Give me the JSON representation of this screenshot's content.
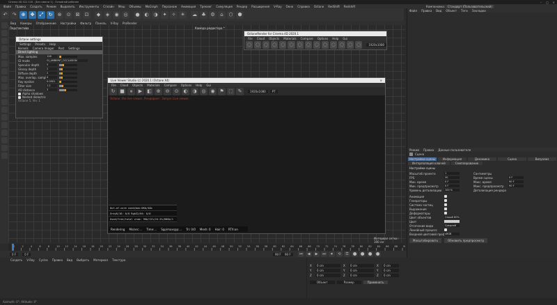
{
  "window": {
    "title": "Cinema 4D S22.118 - [Без имени 1] - Основной рабочее"
  },
  "main_menu": [
    "Файл",
    "Правка",
    "Создать",
    "Режим",
    "Выделить",
    "Инструменты",
    "Сплайн",
    "Меш",
    "Объемы",
    "MoGraph",
    "Персонаж",
    "Анимация",
    "Трекинг",
    "Симуляция",
    "Рендер",
    "Расширения",
    "V-Ray",
    "Окно",
    "Справка",
    "Octane",
    "RedShift",
    "Redshift"
  ],
  "layout_label": "Компоновка:",
  "layout_select": "Стандарт (Пользовательский)",
  "viewport": {
    "menu": [
      "Вид",
      "Камеры",
      "Отображение",
      "Настройки",
      "Фильтр",
      "Панель",
      "V-Ray",
      "ProRender"
    ],
    "label": "Перспектива",
    "camera": "Камера редактора *",
    "grid_info": "Интервал сетки : 100 см"
  },
  "left_panel": {
    "title": "Octane settings",
    "menu": [
      "Settings",
      "Presets",
      "Help"
    ],
    "tabs": [
      "Kernels",
      "Camera Imager",
      "Post",
      "Settings"
    ],
    "mode": "Direct lighting",
    "rows": [
      {
        "label": "Max. samples",
        "value": "128",
        "fill": 0.05
      },
      {
        "label": "GI mode",
        "value": "GI_AMBIENT_OCCLUSION",
        "fill": 0
      },
      {
        "label": "Specular depth",
        "value": "5",
        "fill": 0.2
      },
      {
        "label": "Glossy depth",
        "value": "2",
        "fill": 0.1
      },
      {
        "label": "Diffuse depth",
        "value": "2",
        "fill": 0.1
      },
      {
        "label": "Max. overlap. samples",
        "value": "4",
        "fill": 0.1
      },
      {
        "label": "Ray epsilon",
        "value": "0.0001",
        "fill": 0.02
      },
      {
        "label": "Filter size",
        "value": "1.2",
        "fill": 0.15
      },
      {
        "label": "AO distance",
        "value": "3",
        "fill": 0.3
      }
    ],
    "checks": [
      "Alpha shadows",
      "Nested dielectric"
    ],
    "footer": "Octane 5, Ver. 1"
  },
  "live_viewer": {
    "title": "Live Viewer Studio (c) 2020.1 (Octane X4)",
    "menu": [
      "File",
      "Cloud",
      "Objects",
      "Materials",
      "Compare",
      "Options",
      "Help",
      "Gui"
    ],
    "res": "1920x1080",
    "mode": "PT",
    "status": "Octane: the live viewer, Рендеринг. Запуск Live viewer.",
    "stats": [
      "Out-of-core used/max:0Kb/4Gb",
      "Grey8/16: 0/0        Rgb32/64: 0/0",
      "Used/free/total vram: 9Kb/12%/24.5%/68Gb/1"
    ],
    "footer": [
      "Rendering",
      "Ms/sec:...",
      "Time:...",
      "Spp/maxspp:...",
      "Tri: 0/0",
      "Mesh: 0",
      "Hair: 0",
      "RTX:on"
    ]
  },
  "octane_window": {
    "title": "OctaneRender for Cinema 4D 2020.1",
    "menu": [
      "File",
      "Cloud",
      "Objects",
      "Materials",
      "Compare",
      "Options",
      "Help",
      "Gui"
    ],
    "res": "1920x1080"
  },
  "right_panel": {
    "menu": [
      "Файл",
      "Правка",
      "Вид",
      "Объект",
      "Теги",
      "Закладки"
    ],
    "attr_tabs": [
      "Режим",
      "Правка",
      "Данные пользователя"
    ],
    "attr_title": "Сцена",
    "attr_subtabs": [
      "Настройки сцены",
      "Информация",
      "Динамика",
      "Сцена",
      "Визуализ"
    ],
    "attr_subtabs2": [
      "Интерполяция ключей",
      "Семплирование"
    ],
    "section": "Настройки сцены",
    "rows": [
      {
        "l": "Масштаб проекта",
        "v": "1",
        "l2": "Сантиметры"
      },
      {
        "l": "FPS",
        "v": "30",
        "l2": "Время сцены",
        "v2": "0 F"
      },
      {
        "l": "Мин. время",
        "v": "0 F",
        "l2": "Макс. время",
        "v2": "90 F"
      },
      {
        "l": "Мин. предпросмотр",
        "v": "0 F",
        "l2": "Макс. предпросмотр",
        "v2": "90 F"
      },
      {
        "l": "Уровень детализации",
        "v": "100 %",
        "l2": "Детализация рендера"
      }
    ],
    "checks": [
      "Анимация",
      "Генераторы",
      "Система частиц",
      "Выражения",
      "Деформаторы"
    ],
    "color_label": "Цвет объектов",
    "color_value": "Серый 80%",
    "view_label": "Цвет",
    "clip_label": "Отсечение вида",
    "clip_value": "Средний",
    "linear": "Линейный процесс",
    "input": "Входной цветовой профиль",
    "input_value": "sRGB",
    "btn1": "Масштабировать",
    "btn2": "Обновить предпросмотр"
  },
  "timeline": {
    "ticks": [
      "0",
      "2",
      "4",
      "6",
      "8",
      "10",
      "12",
      "14",
      "16",
      "18",
      "20",
      "22",
      "24",
      "26",
      "28",
      "30",
      "32",
      "34",
      "36",
      "38",
      "40",
      "42",
      "44",
      "46",
      "48",
      "50",
      "52",
      "54",
      "56",
      "58",
      "60",
      "62",
      "64",
      "66",
      "68",
      "70",
      "72",
      "74",
      "76",
      "78",
      "80",
      "82",
      "84",
      "86",
      "88",
      "90"
    ],
    "current": "0 F",
    "start": "0 F",
    "end": "90 F",
    "end2": "90 F"
  },
  "materials_menu": [
    "Создать",
    "V-Ray",
    "Cycles",
    "Правка",
    "Вид",
    "Выбрать",
    "Материал",
    "Текстура"
  ],
  "coords": {
    "rows": [
      "X",
      "Y",
      "Z"
    ],
    "values": [
      "0 cm",
      "0 cm",
      "0 cm"
    ],
    "mode": "Объект",
    "size_mode": "Размер",
    "apply": "Применить"
  },
  "status_bar": "Azimuth: 0°; Altitude: 0°"
}
